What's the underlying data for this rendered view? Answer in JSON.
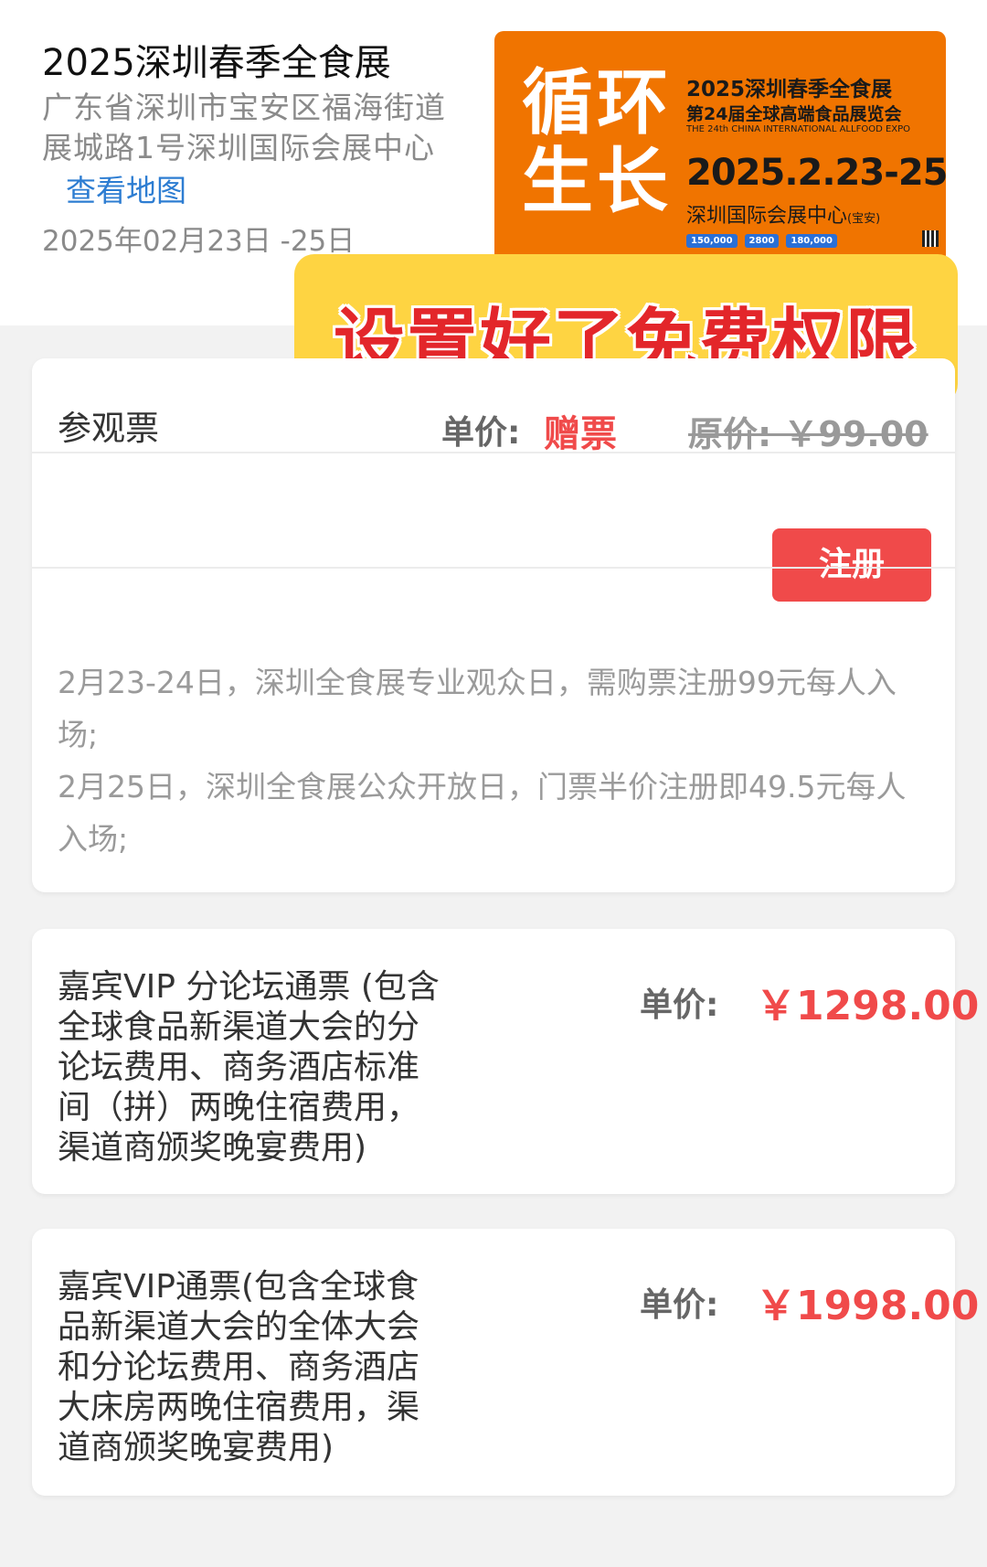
{
  "event": {
    "title": "2025深圳春季全食展",
    "address_lines": [
      "广东省深圳市宝安区福海街道",
      "展城路1号深圳国际会展中心"
    ],
    "map_link": "查看地图",
    "date": "2025年02月23日 -25日"
  },
  "poster": {
    "slogan": [
      "循环",
      "生长"
    ],
    "title": "2025深圳春季全食展",
    "subtitle": "第24届全球高端食品展览会",
    "english": "THE 24th CHINA INTERNATIONAL ALLFOOD EXPO",
    "dates": "2025.2.23-25",
    "venue": "深圳国际会展中心",
    "venue_note": "(宝安)",
    "stats": [
      "150,000",
      "2800",
      "180,000"
    ],
    "bg_color": "#f07400"
  },
  "overlay": {
    "text": "设置好了免费权限",
    "bg_color": "#fed442",
    "text_color": "#e3262a"
  },
  "tickets": [
    {
      "name": "参观票",
      "unit_label": "单价:",
      "price": "赠票",
      "original": "原价: ￥99.00",
      "button": "注册",
      "description": [
        "2月23-24日，深圳全食展专业观众日，需购票注册99元每人入场;",
        "2月25日，深圳全食展公众开放日，门票半价注册即49.5元每人入场;"
      ]
    },
    {
      "name_lines": [
        "嘉宾VIP 分论坛通票 (包含",
        "全球食品新渠道大会的分",
        "论坛费用、商务酒店标准",
        "间（拼）两晚住宿费用，",
        "渠道商颁奖晚宴费用)"
      ],
      "unit_label": "单价:",
      "price": "￥1298.00"
    },
    {
      "name_lines": [
        "嘉宾VIP通票(包含全球食",
        "品新渠道大会的全体大会",
        "和分论坛费用、商务酒店",
        "大床房两晚住宿费用，渠",
        "道商颁奖晚宴费用)"
      ],
      "unit_label": "单价:",
      "price": "￥1998.00"
    }
  ],
  "colors": {
    "price_red": "#f04a4a",
    "link_blue": "#2d7dd2"
  }
}
